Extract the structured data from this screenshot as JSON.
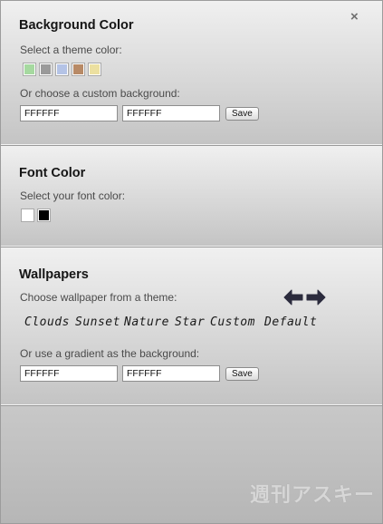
{
  "background_color": {
    "title": "Background Color",
    "theme_label": "Select a theme color:",
    "theme_swatches": [
      "#a6d9a0",
      "#9a9a9a",
      "#b4c3e6",
      "#b88a66",
      "#ece0a0"
    ],
    "custom_label": "Or choose a custom background:",
    "field1_value": "FFFFFF",
    "field2_value": "FFFFFF",
    "save_label": "Save"
  },
  "font_color": {
    "title": "Font Color",
    "select_label": "Select your font color:",
    "swatches": [
      "#ffffff",
      "#000000"
    ]
  },
  "wallpapers": {
    "title": "Wallpapers",
    "theme_label": "Choose wallpaper from a theme:",
    "themes": [
      "Clouds",
      "Sunset",
      "Nature",
      "Star",
      "Custom",
      "Default"
    ],
    "gradient_label": "Or use a gradient as the background:",
    "field1_value": "FFFFFF",
    "field2_value": "FFFFFF",
    "save_label": "Save"
  },
  "close_symbol": "×",
  "watermark": "週刊アスキー",
  "icons": {
    "close": "close-icon",
    "prev": "arrow-left-icon",
    "next": "arrow-right-icon"
  },
  "colors": {
    "arrow": "#2b2b3d"
  }
}
